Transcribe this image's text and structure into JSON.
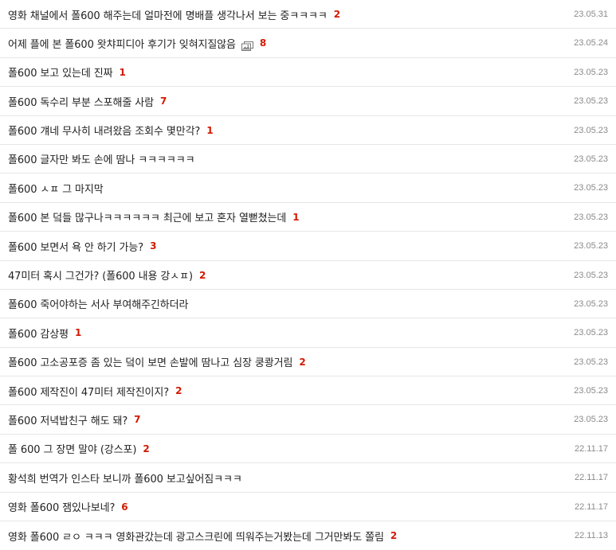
{
  "colors": {
    "comment_count": "#d31900",
    "date": "#8a8a8a",
    "title": "#222222",
    "divider": "#e6e6e6"
  },
  "posts": [
    {
      "title": "영화 채널에서 폴600 해주는데 얼마전에 명배플 생각나서 보는 중ㅋㅋㅋㅋ",
      "has_image": false,
      "comments": "2",
      "date": "23.05.31"
    },
    {
      "title": "어제 플에 본 폴600 왓챠피디아 후기가 잊혀지질않음",
      "has_image": true,
      "image_icon": "image-icon",
      "comments": "8",
      "date": "23.05.24"
    },
    {
      "title": "폴600 보고 있는데 진짜",
      "has_image": false,
      "comments": "1",
      "date": "23.05.23"
    },
    {
      "title": "폴600 독수리 부분 스포해줄 사람",
      "has_image": false,
      "comments": "7",
      "date": "23.05.23"
    },
    {
      "title": "폴600 걔네 무사히 내려왔음 조회수 몇만각?",
      "has_image": false,
      "comments": "1",
      "date": "23.05.23"
    },
    {
      "title": "폴600 글자만 봐도 손에 땀나 ㅋㅋㅋㅋㅋㅋ",
      "has_image": false,
      "comments": "",
      "date": "23.05.23"
    },
    {
      "title": "폴600 ㅅㅍ 그 마지막",
      "has_image": false,
      "comments": "",
      "date": "23.05.23"
    },
    {
      "title": "폴600 본 덬들 많구나ㅋㅋㅋㅋㅋㅋ 최근에 보고 혼자 열뻗쳤는데",
      "has_image": false,
      "comments": "1",
      "date": "23.05.23"
    },
    {
      "title": "폴600 보면서 욕 안 하기 가능?",
      "has_image": false,
      "comments": "3",
      "date": "23.05.23"
    },
    {
      "title": "47미터 혹시 그건가? (폴600 내용 강ㅅㅍ)",
      "has_image": false,
      "comments": "2",
      "date": "23.05.23"
    },
    {
      "title": "폴600 죽어야하는 서사 부여해주긴하더라",
      "has_image": false,
      "comments": "",
      "date": "23.05.23"
    },
    {
      "title": "폴600 감상평",
      "has_image": false,
      "comments": "1",
      "date": "23.05.23"
    },
    {
      "title": "폴600 고소공포증 좀 있는 덬이 보면 손발에 땀나고 심장 쿵쾅거림",
      "has_image": false,
      "comments": "2",
      "date": "23.05.23"
    },
    {
      "title": "폴600 제작진이 47미터 제작진이지?",
      "has_image": false,
      "comments": "2",
      "date": "23.05.23"
    },
    {
      "title": "폴600 저녁밥친구 해도 돼?",
      "has_image": false,
      "comments": "7",
      "date": "23.05.23"
    },
    {
      "title": "폴 600 그 장면 말야 (강스포)",
      "has_image": false,
      "comments": "2",
      "date": "22.11.17"
    },
    {
      "title": "황석희 번역가 인스타 보니까 폴600 보고싶어짐ㅋㅋㅋ",
      "has_image": false,
      "comments": "",
      "date": "22.11.17"
    },
    {
      "title": "영화 폴600 잼있나보네?",
      "has_image": false,
      "comments": "6",
      "date": "22.11.17"
    },
    {
      "title": "영화 폴600 ㄹㅇ ㅋㅋㅋ 영화관갔는데 광고스크린에 띄워주는거봤는데 그거만봐도 쫄림",
      "has_image": false,
      "comments": "2",
      "date": "22.11.13"
    }
  ]
}
